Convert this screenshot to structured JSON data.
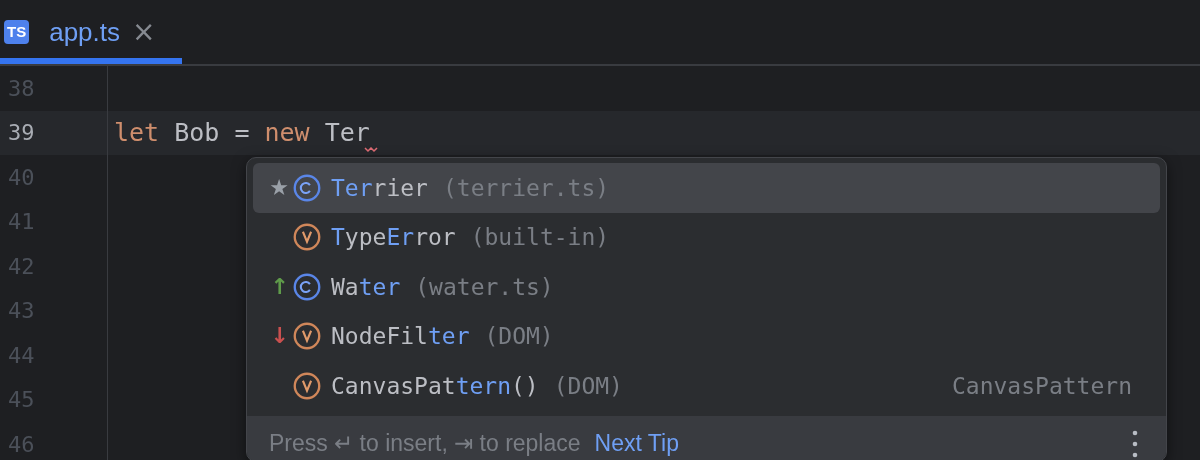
{
  "tab": {
    "label": "app.ts",
    "badge": "TS",
    "close": "×",
    "selected": true
  },
  "editor": {
    "lines": [
      {
        "number": "38",
        "current": false
      },
      {
        "number": "39",
        "current": true,
        "tokens": [
          {
            "text": "let",
            "kind": "keyword"
          },
          {
            "text": " Bob = ",
            "kind": "plain"
          },
          {
            "text": "new",
            "kind": "keyword"
          },
          {
            "text": " Ter",
            "kind": "plain"
          }
        ],
        "error": true
      },
      {
        "number": "40",
        "current": false
      },
      {
        "number": "41",
        "current": false
      },
      {
        "number": "42",
        "current": false
      },
      {
        "number": "43",
        "current": false
      },
      {
        "number": "44",
        "current": false
      },
      {
        "number": "45",
        "current": false
      },
      {
        "number": "46",
        "current": false
      }
    ]
  },
  "completion": {
    "items": [
      {
        "marker": "★",
        "color": "#9aa0a8",
        "kind": "class",
        "selected": true,
        "name_parts": [
          {
            "text": "Ter",
            "matched": true
          },
          {
            "text": "rier",
            "matched": false
          }
        ],
        "detail": "(terrier.ts)"
      },
      {
        "kind": "variable",
        "selected": false,
        "name_parts": [
          {
            "text": "T",
            "matched": true
          },
          {
            "text": "ype",
            "matched": false
          },
          {
            "text": "E",
            "matched": true
          },
          {
            "text": "r",
            "matched": true
          },
          {
            "text": "ror",
            "matched": false
          }
        ],
        "detail": "(built-in)"
      },
      {
        "marker": "↑",
        "color": "#5f9b4a",
        "kind": "class",
        "selected": false,
        "name_parts": [
          {
            "text": "Wa",
            "matched": false
          },
          {
            "text": "ter",
            "matched": true
          }
        ],
        "detail": "(water.ts)"
      },
      {
        "marker": "↓",
        "color": "#c9504f",
        "kind": "variable",
        "selected": false,
        "name_parts": [
          {
            "text": "NodeFil",
            "matched": false
          },
          {
            "text": "ter",
            "matched": true
          }
        ],
        "detail": "(DOM)"
      },
      {
        "kind": "variable",
        "selected": false,
        "name_parts": [
          {
            "text": "CanvasPat",
            "matched": false
          },
          {
            "text": "tern",
            "matched": true
          },
          {
            "text": "()",
            "matched": false
          }
        ],
        "detail": "(DOM)",
        "type_hint": "CanvasPattern"
      }
    ],
    "footer": {
      "hint": "Press ↵ to insert, ⇥ to replace",
      "link": "Next Tip"
    }
  }
}
